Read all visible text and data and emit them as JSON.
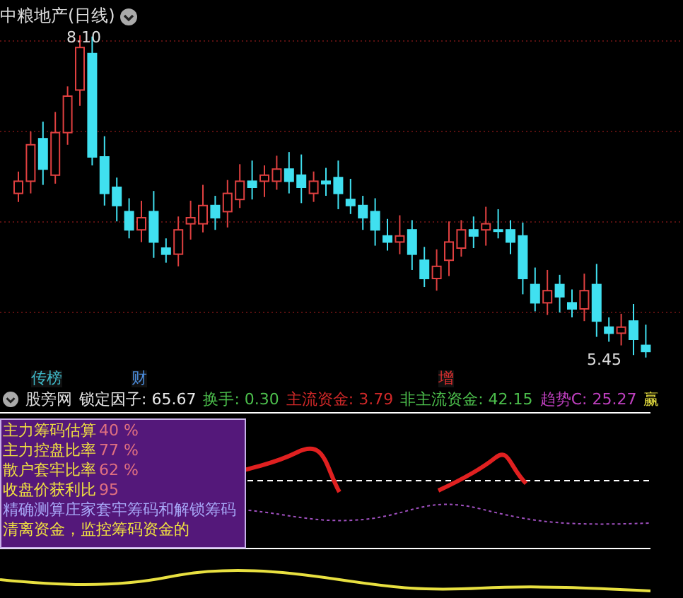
{
  "chart": {
    "title": "中粮地产(日线)",
    "high_label": "8.10",
    "low_label": "5.45"
  },
  "markers": [
    {
      "text": "传榜",
      "color": "#3fb8c8"
    },
    {
      "text": "财",
      "color": "#4a8ad8"
    },
    {
      "text": "增",
      "color": "#e03030"
    }
  ],
  "legend": {
    "name": "股旁网",
    "items": [
      {
        "text": "锁定因子: 65.67",
        "color": "#e8e8e8"
      },
      {
        "text": "换手: 0.30",
        "color": "#4cbf4c"
      },
      {
        "text": "主流资金: 3.79",
        "color": "#d02828"
      },
      {
        "text": "非主流资金: 42.15",
        "color": "#4cbf4c"
      },
      {
        "text": "趋势C: 25.27",
        "color": "#c040c0"
      },
      {
        "text": "赢",
        "color": "#e8e040"
      }
    ]
  },
  "info_box": {
    "rows": [
      {
        "label": "主力筹码估算",
        "value": "40 %"
      },
      {
        "label": "主力控盘比率",
        "value": "77 %"
      },
      {
        "label": "散户套牢比率",
        "value": "62 %"
      },
      {
        "label": "收盘价获利比",
        "value": "95"
      }
    ],
    "notes": [
      "精确测算庄家套牢筹码和解锁筹码",
      "清离资金，监控筹码资金的"
    ]
  }
}
